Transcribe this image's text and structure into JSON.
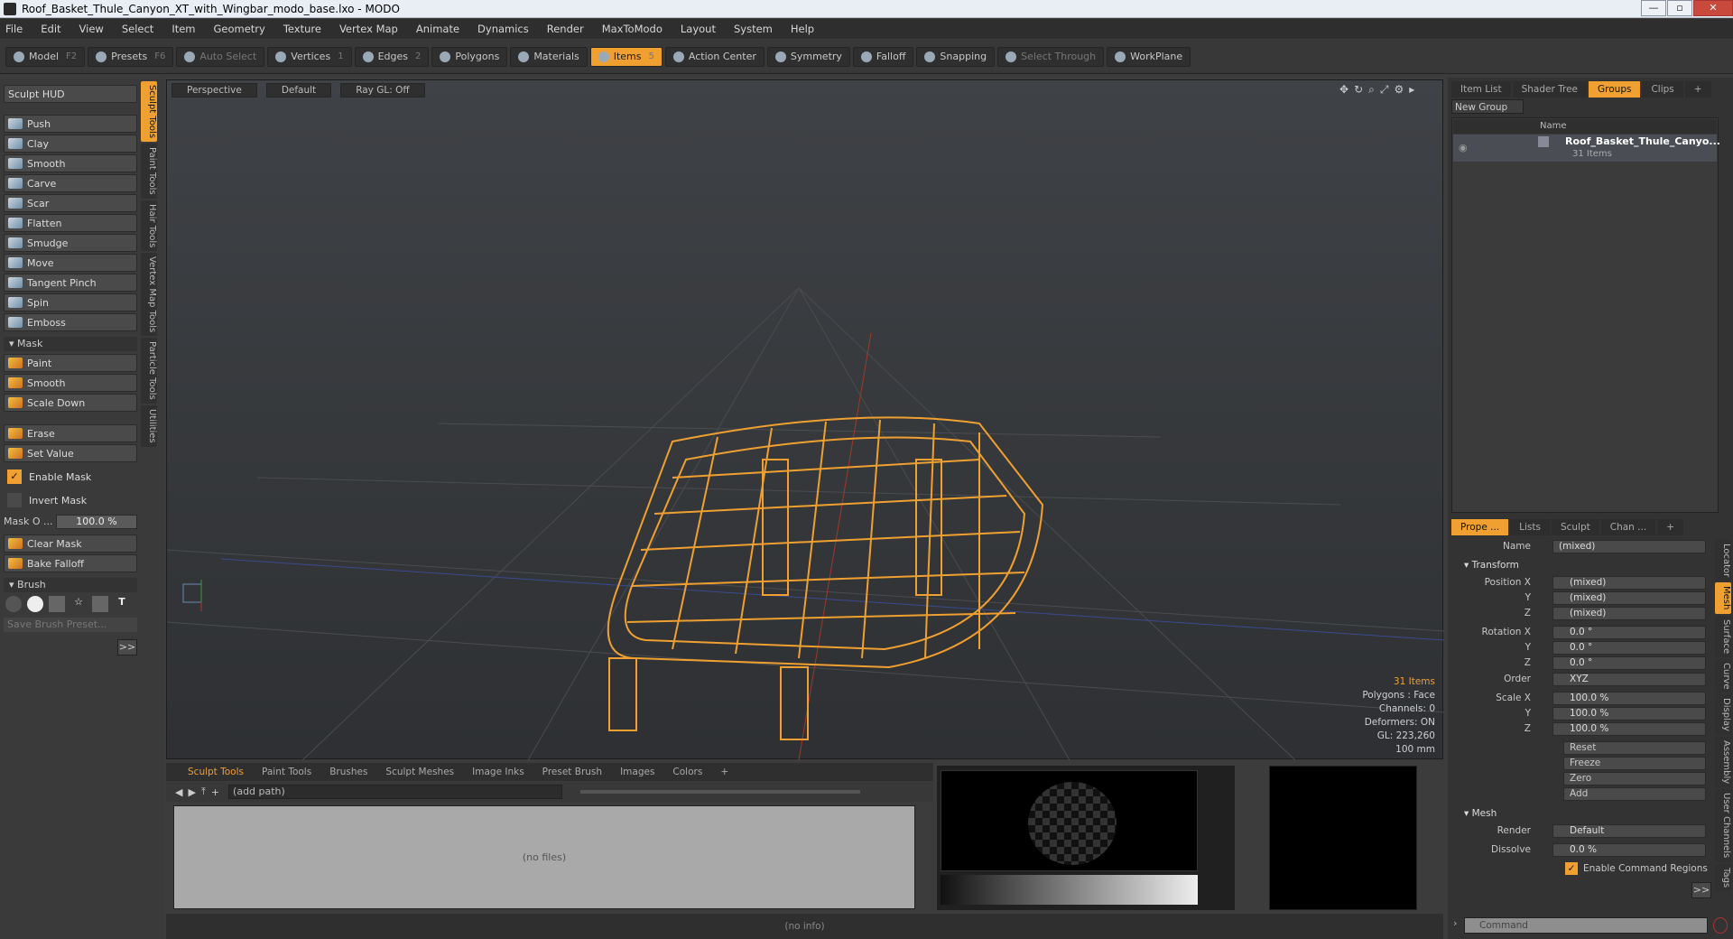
{
  "window": {
    "title": "Roof_Basket_Thule_Canyon_XT_with_Wingbar_modo_base.lxo - MODO"
  },
  "menu": [
    "File",
    "Edit",
    "View",
    "Select",
    "Item",
    "Geometry",
    "Texture",
    "Vertex Map",
    "Animate",
    "Dynamics",
    "Render",
    "MaxToModo",
    "Layout",
    "System",
    "Help"
  ],
  "toolbar": {
    "model": "Model",
    "model_key": "F2",
    "presets": "Presets",
    "presets_key": "F6",
    "auto_select": "Auto Select",
    "vertices": "Vertices",
    "vertices_key": "1",
    "edges": "Edges",
    "edges_key": "2",
    "polygons": "Polygons",
    "materials": "Materials",
    "items": "Items",
    "items_key": "5",
    "action_center": "Action Center",
    "symmetry": "Symmetry",
    "falloff": "Falloff",
    "snapping": "Snapping",
    "select_through": "Select Through",
    "workplane": "WorkPlane"
  },
  "left": {
    "hud": "Sculpt HUD",
    "tools": [
      "Push",
      "Clay",
      "Smooth",
      "Carve",
      "Scar",
      "Flatten",
      "Smudge",
      "Move",
      "Tangent Pinch",
      "Spin",
      "Emboss"
    ],
    "mask_section": "Mask",
    "mask_tools": [
      "Paint",
      "Smooth",
      "Scale Down"
    ],
    "erase": "Erase",
    "set_value": "Set Value",
    "enable_mask": "Enable Mask",
    "invert_mask": "Invert Mask",
    "mask_opacity_label": "Mask O ...",
    "mask_opacity_value": "100.0 %",
    "clear_mask": "Clear Mask",
    "bake_falloff": "Bake Falloff",
    "brush_section": "Brush",
    "save_brush": "Save Brush Preset...",
    "expand": ">>",
    "vtabs": [
      "Sculpt Tools",
      "Paint Tools",
      "Hair Tools",
      "Vertex Map Tools",
      "Particle Tools",
      "Utilities"
    ]
  },
  "viewport": {
    "view": "Perspective",
    "shading": "Default",
    "raygl": "Ray GL: Off",
    "info": {
      "items": "31 Items",
      "polygons": "Polygons : Face",
      "channels": "Channels: 0",
      "deformers": "Deformers: ON",
      "gl": "GL: 223,260",
      "scale": "100 mm"
    }
  },
  "bottom": {
    "tabs": [
      "Sculpt Tools",
      "Paint Tools",
      "Brushes",
      "Sculpt Meshes",
      "Image Inks",
      "Preset Brush",
      "Images",
      "Colors",
      "+"
    ],
    "path": "(add path)",
    "nofiles": "(no files)",
    "status": "(no info)"
  },
  "right": {
    "top_tabs": [
      "Item List",
      "Shader Tree",
      "Groups",
      "Clips",
      "+"
    ],
    "new_group": "New Group",
    "col_name": "Name",
    "group_name": "Roof_Basket_Thule_Canyo...",
    "group_count": "31 Items",
    "prop_tabs": [
      "Prope ...",
      "Lists",
      "Sculpt",
      "Chan ...",
      "+"
    ],
    "name_label": "Name",
    "name_value": "(mixed)",
    "transform": "Transform",
    "pos_labels": [
      "Position X",
      "Y",
      "Z"
    ],
    "pos_values": [
      "(mixed)",
      "(mixed)",
      "(mixed)"
    ],
    "rot_labels": [
      "Rotation X",
      "Y",
      "Z"
    ],
    "rot_values": [
      "0.0 °",
      "0.0 °",
      "0.0 °"
    ],
    "order_label": "Order",
    "order_value": "XYZ",
    "scale_labels": [
      "Scale X",
      "Y",
      "Z"
    ],
    "scale_values": [
      "100.0 %",
      "100.0 %",
      "100.0 %"
    ],
    "actions": [
      "Reset",
      "Freeze",
      "Zero",
      "Add"
    ],
    "mesh": "Mesh",
    "render_label": "Render",
    "render_value": "Default",
    "dissolve_label": "Dissolve",
    "dissolve_value": "0.0 %",
    "enable_cmd": "Enable Command Regions",
    "expand": ">>",
    "vtabs": [
      "Locator",
      "Mesh",
      "Surface",
      "Curve",
      "Display",
      "Assembly",
      "User Channels",
      "Tags"
    ],
    "command": "Command"
  },
  "colors": {
    "accent": "#f0a030"
  }
}
